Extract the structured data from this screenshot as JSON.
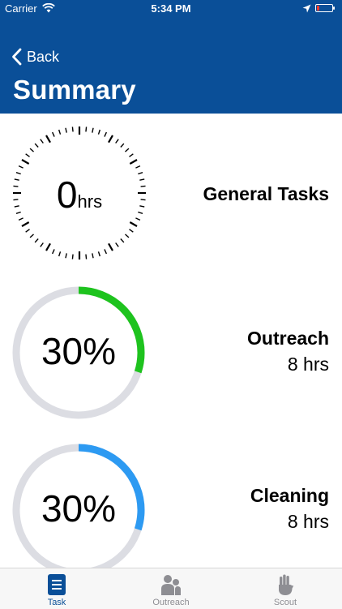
{
  "status_bar": {
    "carrier": "Carrier",
    "time": "5:34 PM"
  },
  "header": {
    "back_label": "Back",
    "title": "Summary"
  },
  "summaries": [
    {
      "value_number": "0",
      "value_unit": "hrs",
      "title": "General Tasks"
    },
    {
      "percent_label": "30%",
      "progress": 0.3,
      "title": "Outreach",
      "hours": "8 hrs",
      "ring_color": "#1ec31e"
    },
    {
      "percent_label": "30%",
      "progress": 0.3,
      "title": "Cleaning",
      "hours": "8 hrs",
      "ring_color": "#2d9af2"
    }
  ],
  "tabs": [
    {
      "label": "Task",
      "icon": "list-icon",
      "active": true
    },
    {
      "label": "Outreach",
      "icon": "people-icon",
      "active": false
    },
    {
      "label": "Scout",
      "icon": "scout-hand-icon",
      "active": false
    }
  ],
  "colors": {
    "brand": "#0a4f98",
    "ring_track": "#dcdde3",
    "inactive_tab": "#8e8e93"
  }
}
